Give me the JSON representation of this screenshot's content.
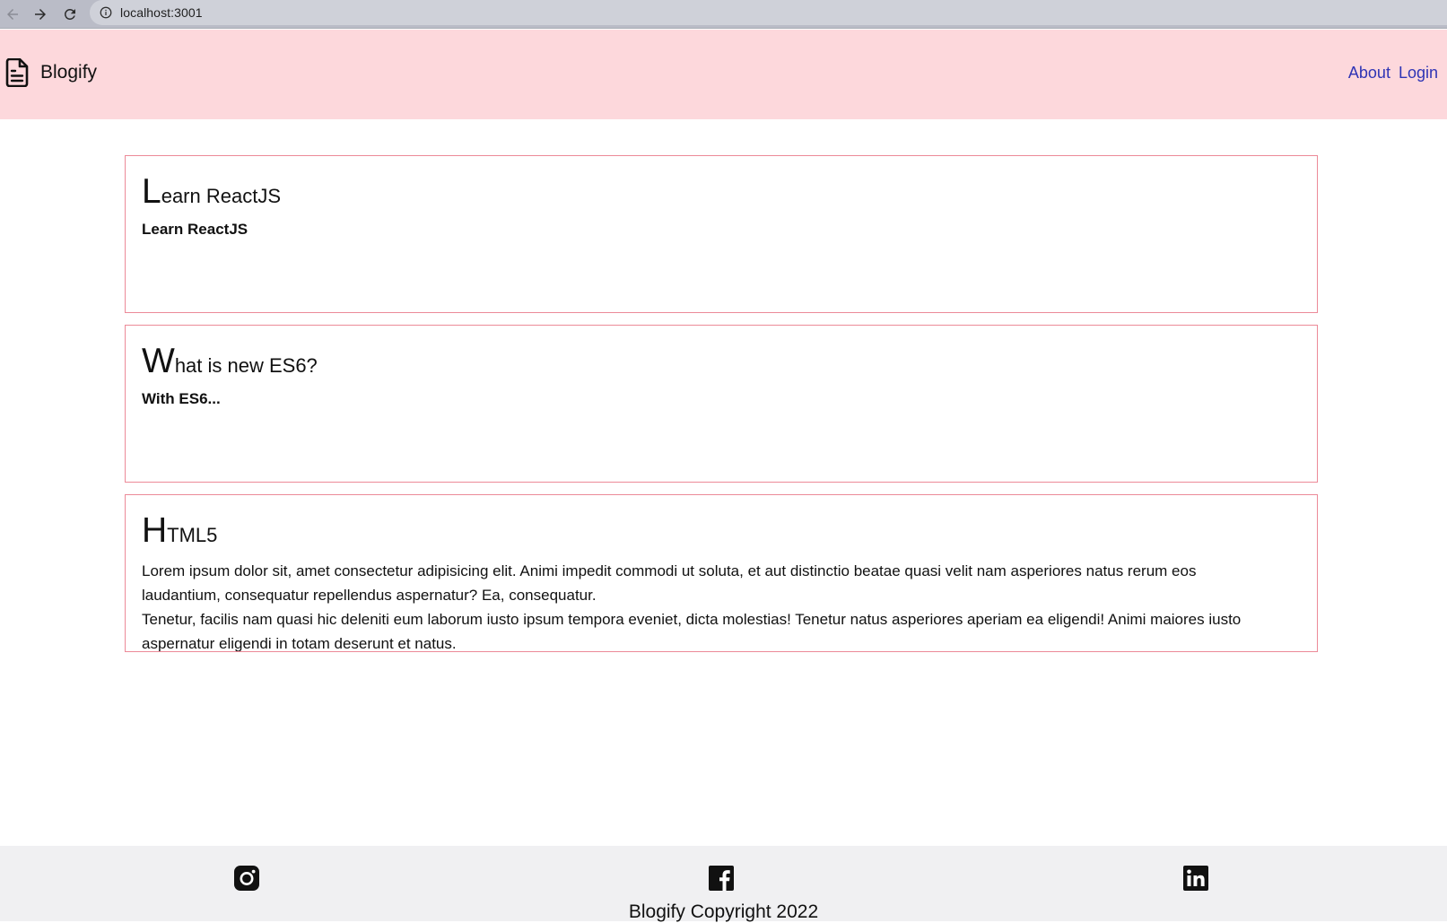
{
  "browser": {
    "url": "localhost:3001"
  },
  "header": {
    "brand": "Blogify",
    "nav": [
      {
        "label": "About"
      },
      {
        "label": "Login"
      }
    ],
    "background": "#fdd8dc",
    "link_color": "#2f34b5"
  },
  "posts": [
    {
      "title": "Learn ReactJS",
      "summary": "Learn ReactJS"
    },
    {
      "title": "What is new ES6?",
      "summary": "With ES6..."
    },
    {
      "title": "HTML5",
      "body": [
        "Lorem ipsum dolor sit, amet consectetur adipisicing elit. Animi impedit commodi ut soluta, et aut distinctio beatae quasi velit nam asperiores natus rerum eos laudantium, consequatur repellendus aspernatur? Ea, consequatur.",
        "Tenetur, facilis nam quasi hic deleniti eum laborum iusto ipsum tempora eveniet, dicta molestias! Tenetur natus asperiores aperiam ea eligendi! Animi maiores iusto aspernatur eligendi in totam deserunt et natus."
      ]
    }
  ],
  "footer": {
    "icons": [
      "instagram-icon",
      "facebook-icon",
      "linkedin-icon"
    ],
    "copyright": "Blogify Copyright 2022"
  },
  "colors": {
    "card_border": "#ec8a98",
    "footer_background": "#f0f0f2"
  }
}
